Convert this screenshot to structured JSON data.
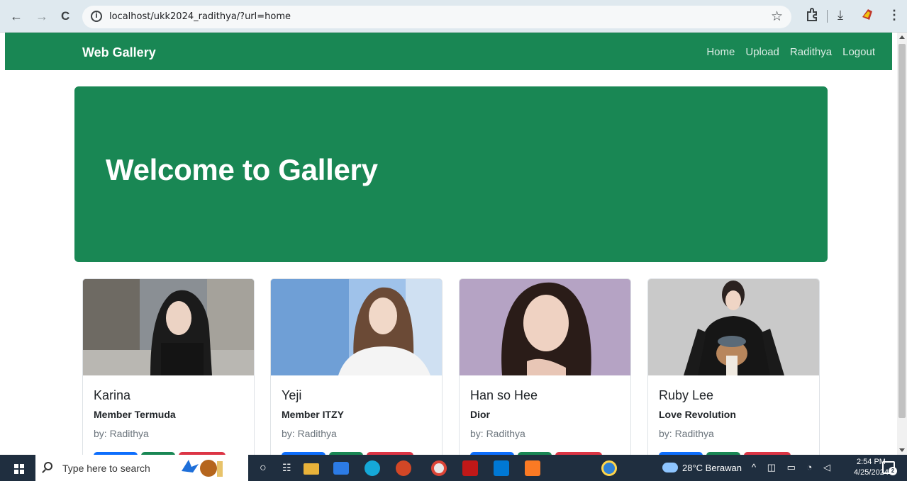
{
  "browser": {
    "url": "localhost/ukk2024_radithya/?url=home",
    "icons": [
      "back-arrow-icon",
      "forward-arrow-icon",
      "reload-icon",
      "site-info-icon",
      "bookmark-star-icon",
      "extensions-icon",
      "download-icon",
      "profile-icon",
      "menu-icon"
    ]
  },
  "navbar": {
    "brand": "Web Gallery",
    "links": [
      "Home",
      "Upload",
      "Radithya",
      "Logout"
    ],
    "color": "#198754"
  },
  "hero": {
    "title": "Welcome to Gallery",
    "color": "#198754"
  },
  "cards": [
    {
      "title": "Karina",
      "subtitle": "Member Termuda",
      "by": "by: Radithya"
    },
    {
      "title": "Yeji",
      "subtitle": "Member ITZY",
      "by": "by: Radithya"
    },
    {
      "title": "Han so Hee",
      "subtitle": "Dior",
      "by": "by: Radithya"
    },
    {
      "title": "Ruby Lee",
      "subtitle": "Love Revolution",
      "by": "by: Radithya"
    }
  ],
  "button_colors": {
    "primary": "#0d6efd",
    "success": "#198754",
    "danger": "#dc3545"
  },
  "taskbar": {
    "search_placeholder": "Type here to search",
    "weather": "28°C  Berawan",
    "time": "2:54 PM",
    "date": "4/25/2024",
    "notifications": "2"
  }
}
